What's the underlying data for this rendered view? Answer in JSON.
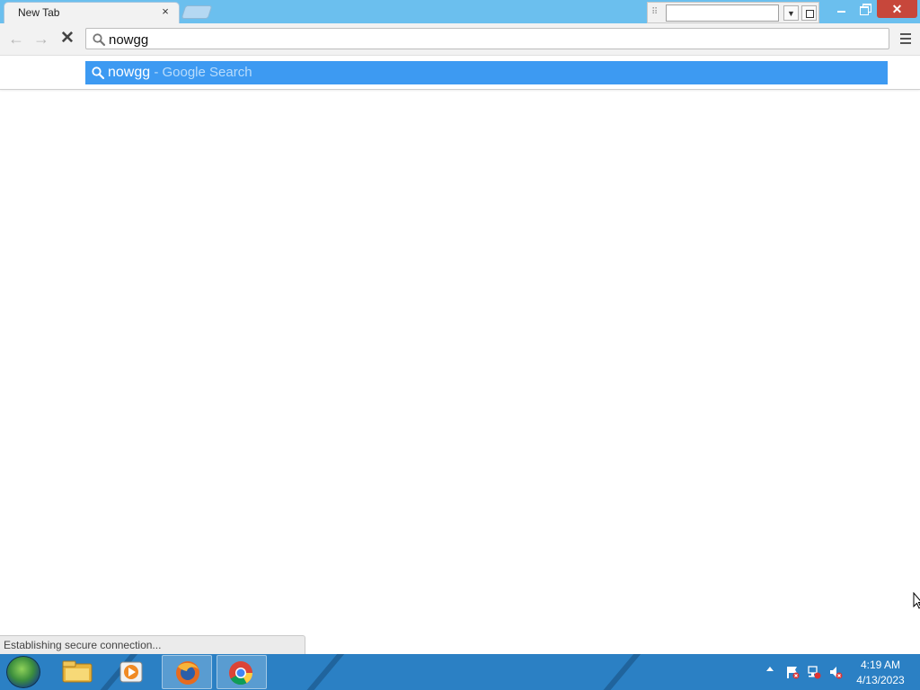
{
  "browser": {
    "tab_title": "New Tab",
    "tab_close": "×",
    "omnibox_text": "nowgg",
    "suggestion": {
      "query": "nowgg",
      "description": " - Google Search"
    },
    "status_text": "Establishing secure connection...",
    "nav": {
      "back": "←",
      "forward": "→",
      "stop": "✕"
    },
    "window_close": "✕"
  },
  "taskbar": {
    "clock_time": "4:19 AM",
    "clock_date": "4/13/2023",
    "items": [
      "file-explorer-icon",
      "media-player-icon",
      "firefox-icon",
      "chrome-icon"
    ]
  },
  "colors": {
    "titlebar": "#6bbfee",
    "suggestion_highlight": "#3d9af2",
    "taskbar": "#2b80c4",
    "close_button": "#c7473b"
  }
}
